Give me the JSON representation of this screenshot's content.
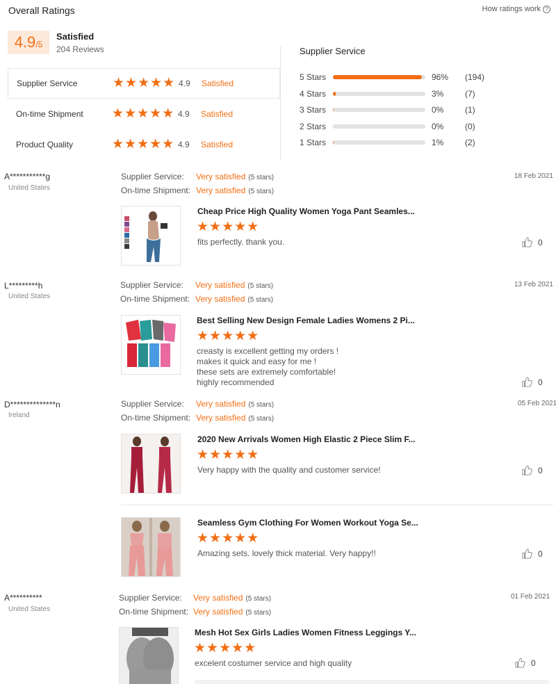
{
  "header": {
    "title": "Overall Ratings",
    "how_link": "How ratings work",
    "help_icon": "?"
  },
  "summary": {
    "score": "4.9",
    "out_of": "/5",
    "label": "Satisfied",
    "reviews": "204 Reviews"
  },
  "categories": [
    {
      "label": "Supplier Service",
      "rating": "4.9",
      "status": "Satisfied"
    },
    {
      "label": "On-time Shipment",
      "rating": "4.9",
      "status": "Satisfied"
    },
    {
      "label": "Product Quality",
      "rating": "4.9",
      "status": "Satisfied"
    }
  ],
  "distribution": {
    "title": "Supplier Service",
    "rows": [
      {
        "label": "5 Stars",
        "pct": "96%",
        "count": "(194)",
        "fraction": 0.96
      },
      {
        "label": "4 Stars",
        "pct": "3%",
        "count": "(7)",
        "fraction": 0.03
      },
      {
        "label": "3 Stars",
        "pct": "0%",
        "count": "(1)",
        "fraction": 0.005
      },
      {
        "label": "2 Stars",
        "pct": "0%",
        "count": "(0)",
        "fraction": 0.0
      },
      {
        "label": "1 Stars",
        "pct": "1%",
        "count": "(2)",
        "fraction": 0.01
      }
    ]
  },
  "stars_glyph": "★★★★★",
  "thumb_icon": "thumbs-up",
  "attr_labels": {
    "supplier": "Supplier Service:",
    "shipment": "On-time Shipment:",
    "value": "Very satisfied",
    "stars": "(5 stars)"
  },
  "reviews": [
    {
      "name": "A***********g",
      "country": "United States",
      "date": "18 Feb 2021",
      "products": [
        {
          "title": "Cheap Price High Quality Women Yoga Pant Seamles...",
          "text": "fits perfectly. thank you.",
          "likes": "0"
        }
      ]
    },
    {
      "name": "L*********h",
      "country": "United States",
      "date": "13 Feb 2021",
      "products": [
        {
          "title": "Best Selling New Design Female Ladies Womens 2 Pi...",
          "text": "creasty is excellent getting my orders !\nmakes it quick and easy for me !\nthese sets are extremely comfortable!\nhighly recommended",
          "likes": "0"
        }
      ]
    },
    {
      "name": "D**************n",
      "country": "Ireland",
      "date": "05 Feb 2021",
      "products": [
        {
          "title": "2020 New Arrivals Women High Elastic 2 Piece Slim F...",
          "text": "Very happy with the quality and customer service!",
          "likes": "0"
        },
        {
          "title": "Seamless Gym Clothing For Women Workout Yoga Se...",
          "text": "Amazing sets. lovely thick material. Very happy!!",
          "likes": "0"
        }
      ]
    },
    {
      "name": "A**********",
      "country": "United States",
      "date": "01 Feb 2021",
      "products": [
        {
          "title": "Mesh Hot Sex Girls Ladies Women Fitness Leggings Y...",
          "text": "excelent costumer service and high quality",
          "likes": "0"
        }
      ]
    }
  ]
}
